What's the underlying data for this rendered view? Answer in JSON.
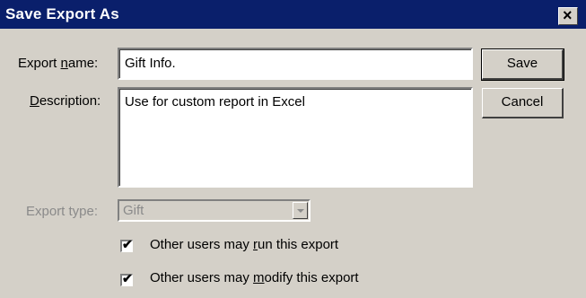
{
  "dialog": {
    "title": "Save Export As",
    "close_glyph": "×"
  },
  "form": {
    "export_name_label_pre": "Export ",
    "export_name_label_u": "n",
    "export_name_label_post": "ame:",
    "export_name_value": "Gift Info.",
    "description_label_u": "D",
    "description_label_post": "escription:",
    "description_value": "Use for custom report in Excel",
    "export_type_label": "Export type:",
    "export_type_value": "Gift"
  },
  "buttons": {
    "save": "Save",
    "cancel": "Cancel"
  },
  "options": {
    "run_pre": "Other users may ",
    "run_u": "r",
    "run_post": "un this export",
    "run_checked": true,
    "modify_pre": "Other users may ",
    "modify_u": "m",
    "modify_post": "odify this export",
    "modify_checked": true
  },
  "icons": {
    "close": "close-icon",
    "dropdown": "chevron-down-icon",
    "check": "checkmark-icon"
  }
}
